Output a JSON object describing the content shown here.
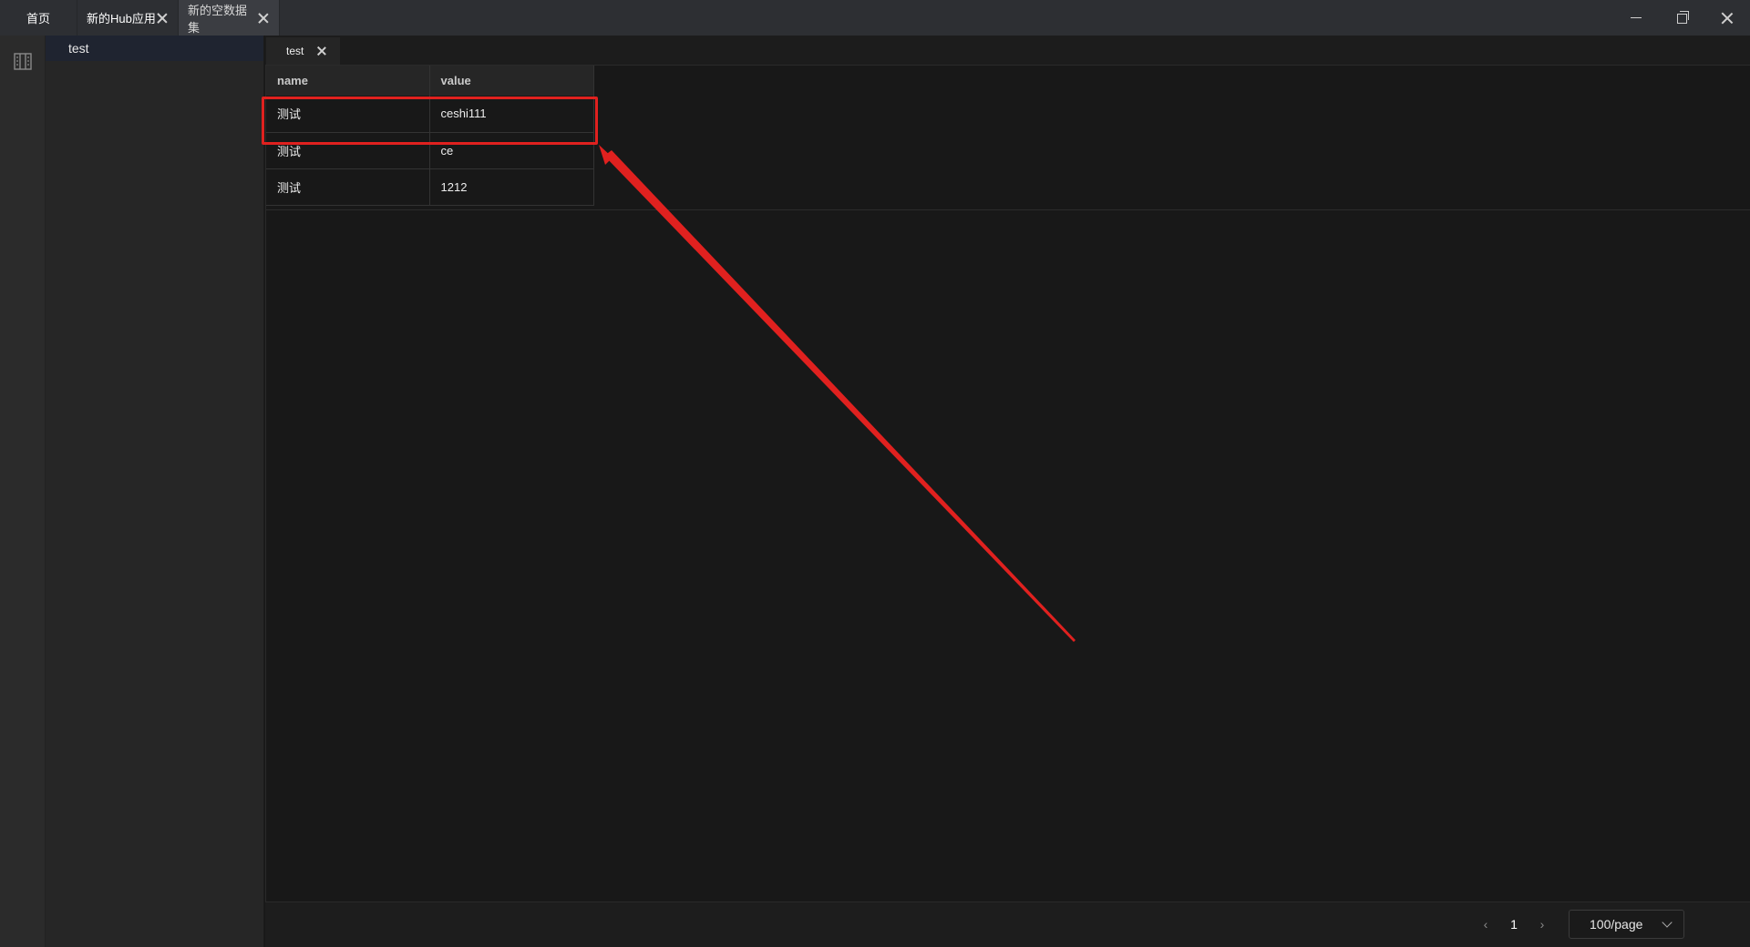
{
  "titlebar": {
    "tabs": [
      {
        "label": "首页"
      },
      {
        "label": "新的Hub应用"
      },
      {
        "label": "新的空数据集"
      }
    ]
  },
  "rail": {
    "icon": "building-icon"
  },
  "tree": {
    "items": [
      {
        "label": "test"
      }
    ]
  },
  "sheet": {
    "tab_label": "test"
  },
  "table": {
    "columns": [
      "name",
      "value"
    ],
    "rows": [
      [
        "测试",
        "ceshi111"
      ],
      [
        "测试",
        "ce"
      ],
      [
        "测试",
        "1212"
      ]
    ]
  },
  "pagination": {
    "current_page": "1",
    "page_size": "100/page"
  },
  "annotation": {
    "color": "#e0211f"
  }
}
